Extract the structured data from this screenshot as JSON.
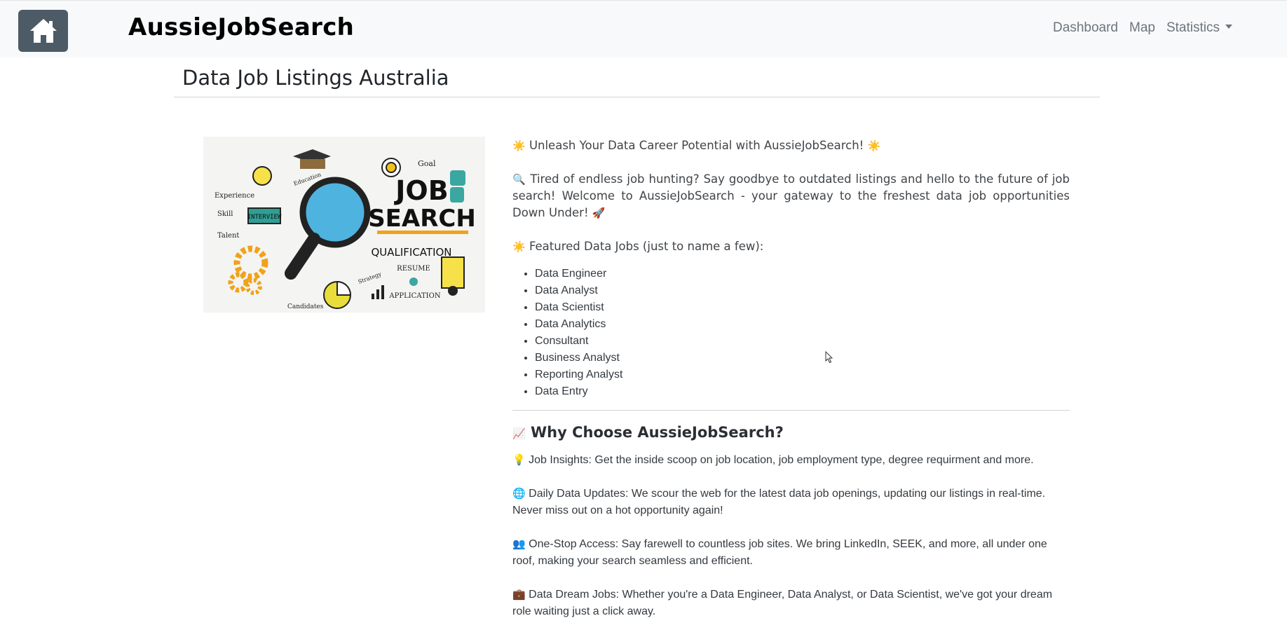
{
  "navbar": {
    "brand": "AussieJobSearch",
    "links": [
      "Dashboard",
      "Map",
      "Statistics"
    ]
  },
  "page": {
    "title": "Data Job Listings Australia"
  },
  "hero_image": {
    "text_words": [
      "Goal",
      "JOB",
      "SEARCH",
      "QUALIFICATION",
      "RESUME",
      "APPLICATION",
      "INTERVIEW",
      "Experience",
      "Skill",
      "Talent",
      "Education",
      "Strategy",
      "Candidates"
    ]
  },
  "intro": {
    "headline": "Unleash Your Data Career Potential with AussieJobSearch!",
    "paragraph": "Tired of endless job hunting? Say goodbye to outdated listings and hello to the future of job search! Welcome to AussieJobSearch - your gateway to the freshest data job opportunities Down Under!",
    "featured_label": "Featured Data Jobs (just to name a few):",
    "jobs": [
      "Data Engineer",
      "Data Analyst",
      "Data Scientist",
      "Data Analytics",
      "Consultant",
      "Business Analyst",
      "Reporting Analyst",
      "Data Entry"
    ]
  },
  "why": {
    "heading": "Why Choose AussieJobSearch?",
    "features": [
      {
        "icon": "lightbulb-icon",
        "text": "Job Insights: Get the inside scoop on job location, job employment type, degree requirment and more."
      },
      {
        "icon": "globe-icon",
        "text": "Daily Data Updates: We scour the web for the latest data job openings, updating our listings in real-time. Never miss out on a hot opportunity again!"
      },
      {
        "icon": "people-icon",
        "text": "One-Stop Access: Say farewell to countless job sites. We bring LinkedIn, SEEK, and more, all under one roof, making your search seamless and efficient."
      },
      {
        "icon": "briefcase-icon",
        "text": "Data Dream Jobs: Whether you're a Data Engineer, Data Analyst, or Data Scientist, we've got your dream role waiting just a click away."
      }
    ]
  },
  "colors": {
    "navbar_bg": "#f8f9fa",
    "home_button_bg": "#4c5b66",
    "nav_link": "#6c757d"
  }
}
